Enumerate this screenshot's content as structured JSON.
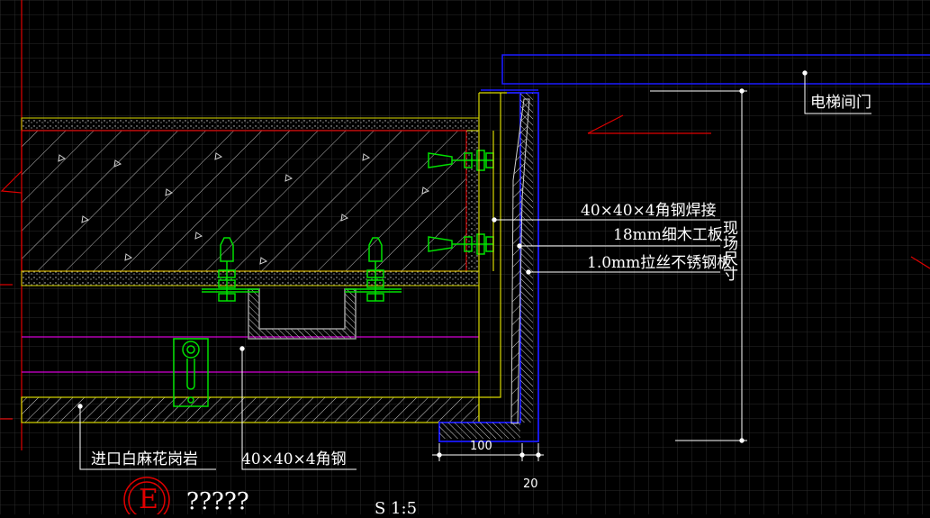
{
  "annotations": {
    "elevator_door": "电梯间门",
    "angle_steel_weld": "40×40×4角钢焊接",
    "plywood": "18mm细木工板",
    "stainless_plate": "1.0mm拉丝不锈钢板",
    "vertical_dim_text": "现场尺寸",
    "granite": "进口白麻花岗岩",
    "angle_steel": "40×40×4角钢"
  },
  "dimensions": {
    "width_100": "100",
    "width_20": "20"
  },
  "title_block": {
    "symbol_letter": "E",
    "title": "?????",
    "scale": "S 1:5"
  },
  "colors": {
    "background": "#000000",
    "grid": "#2b2b2b",
    "yellow": "#d8d800",
    "magenta": "#d400d4",
    "red": "#e00000",
    "blue": "#1a1aff",
    "green": "#00e000",
    "white": "#ffffff",
    "grey": "#9a9a9a"
  }
}
